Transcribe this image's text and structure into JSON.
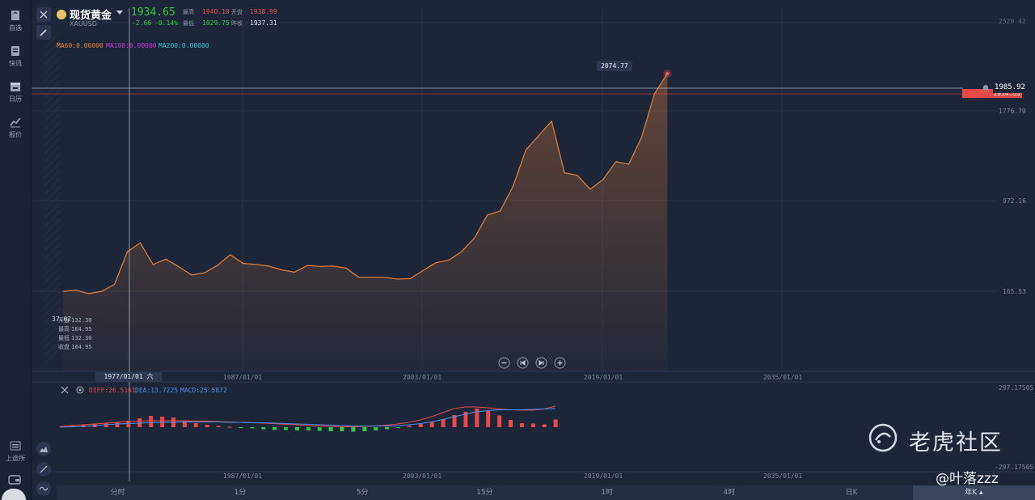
{
  "sidebar": {
    "items": [
      {
        "label": "自选",
        "icon": "bookmark-icon"
      },
      {
        "label": "快讯",
        "icon": "news-icon"
      },
      {
        "label": "日历",
        "icon": "calendar-icon"
      },
      {
        "label": "报价",
        "icon": "chart-line-icon"
      }
    ],
    "bottom_label": "上途所"
  },
  "header": {
    "name": "现货黄金",
    "symbol": "XAUUSD",
    "price": "1934.65",
    "change": "-2.66",
    "change_pct": "-0.14%",
    "high_label": "最高",
    "high": "1940.10",
    "open_label": "开盘",
    "open": "1938.99",
    "low_label": "最低",
    "low": "1929.75",
    "prev_label": "昨收",
    "prev": "1937.31"
  },
  "ma": {
    "ma60": "MA60:0.00000",
    "ma100": "MA100:0.00000",
    "ma200": "MA200:0.00000"
  },
  "price_axis": [
    "2520.42",
    "1776.79",
    "972.16",
    "165.53"
  ],
  "callout": "2074.77",
  "last_price_tag": "1934.65",
  "crosshair_price": "1985.92",
  "left_edge_value": "37.62",
  "ohlc_box": {
    "open_label": "开盘",
    "open": "132.30",
    "high_label": "最高",
    "high": "164.95",
    "low_label": "最低",
    "low": "132.30",
    "close_label": "收盘",
    "close": "164.95"
  },
  "date_cursor": "1977/01/01 六",
  "date_axis": [
    "1987/01/01",
    "2003/01/01",
    "2019/01/01",
    "2035/01/01"
  ],
  "macd": {
    "diff": "DIFF:26.5161",
    "dea": "DEA:13.7225",
    "macd": "MACD:25.5872",
    "axis_top": "297.17505",
    "axis_bottom": "-297.17505"
  },
  "timeframes": [
    "分时",
    "1分",
    "5分",
    "15分",
    "1时",
    "4时",
    "日K",
    "年K ▴"
  ],
  "active_timeframe": "年K ▴",
  "watermark": "老虎社区",
  "author": "@叶落zzz",
  "colors": {
    "up": "#e84a4a",
    "down": "#2ecc40",
    "line": "#e8813a",
    "bg": "#1d2639"
  },
  "chart_data": {
    "type": "area",
    "x": [
      "1974",
      "1975",
      "1976",
      "1977",
      "1978",
      "1979",
      "1980",
      "1981",
      "1982",
      "1983",
      "1984",
      "1985",
      "1986",
      "1987",
      "1988",
      "1989",
      "1990",
      "1991",
      "1992",
      "1993",
      "1994",
      "1995",
      "1996",
      "1997",
      "1998",
      "1999",
      "2000",
      "2001",
      "2002",
      "2003",
      "2004",
      "2005",
      "2006",
      "2007",
      "2008",
      "2009",
      "2010",
      "2011",
      "2012",
      "2013",
      "2014",
      "2015",
      "2016",
      "2017",
      "2018",
      "2019",
      "2020",
      "2021",
      "2022",
      "2023"
    ],
    "y": [
      165,
      175,
      145,
      165,
      226,
      512,
      590,
      400,
      447,
      380,
      308,
      327,
      391,
      487,
      410,
      401,
      386,
      353,
      333,
      391,
      383,
      387,
      369,
      289,
      288,
      288,
      272,
      276,
      347,
      416,
      438,
      513,
      632,
      834,
      869,
      1087,
      1405,
      1531,
      1657,
      1204,
      1182,
      1060,
      1146,
      1302,
      1279,
      1517,
      1897,
      2074,
      null,
      null
    ]
  },
  "macd_data": {
    "bars": [
      2,
      5,
      7,
      9,
      10,
      12,
      16,
      22,
      28,
      26,
      24,
      16,
      10,
      6,
      3,
      1,
      -1,
      -3,
      -5,
      -7,
      -7,
      -8,
      -8,
      -9,
      -10,
      -10,
      -11,
      -10,
      -8,
      -5,
      -2,
      3,
      8,
      14,
      20,
      30,
      38,
      46,
      40,
      29,
      18,
      10,
      9,
      7,
      19
    ],
    "diff": [
      2,
      4,
      6,
      8,
      10,
      12,
      14,
      15,
      16,
      16,
      16,
      16,
      15,
      15,
      14,
      13,
      12,
      11,
      10,
      9,
      7,
      6,
      4,
      3,
      2,
      1,
      1,
      2,
      3,
      5,
      8,
      12,
      18,
      26,
      36,
      46,
      50,
      50,
      48,
      45,
      43,
      42,
      42,
      45,
      52
    ],
    "dea": [
      0,
      1,
      2,
      4,
      6,
      8,
      9,
      10,
      11,
      12,
      12,
      13,
      13,
      13,
      13,
      12,
      12,
      11,
      11,
      10,
      9,
      8,
      7,
      6,
      5,
      4,
      3,
      3,
      3,
      3,
      4,
      6,
      9,
      13,
      19,
      26,
      32,
      38,
      41,
      43,
      43,
      43,
      44,
      45,
      46
    ]
  }
}
